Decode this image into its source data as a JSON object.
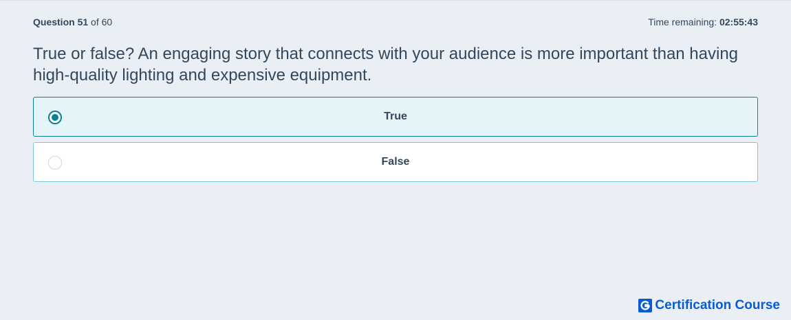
{
  "header": {
    "question_prefix": "Question",
    "question_number": "51",
    "question_of": "of 60",
    "time_label": "Time remaining:",
    "time_value": "02:55:43"
  },
  "question": {
    "text": "True or false? An engaging story that connects with your audience is more important than having high-quality lighting and expensive equipment."
  },
  "options": [
    {
      "label": "True",
      "selected": true
    },
    {
      "label": "False",
      "selected": false
    }
  ],
  "brand": {
    "name": "Certification Course",
    "icon": "g-logo-icon",
    "color": "#0a5bd0"
  },
  "colors": {
    "accent": "#0a8196",
    "background": "#eaeff6",
    "text": "#33475b"
  }
}
